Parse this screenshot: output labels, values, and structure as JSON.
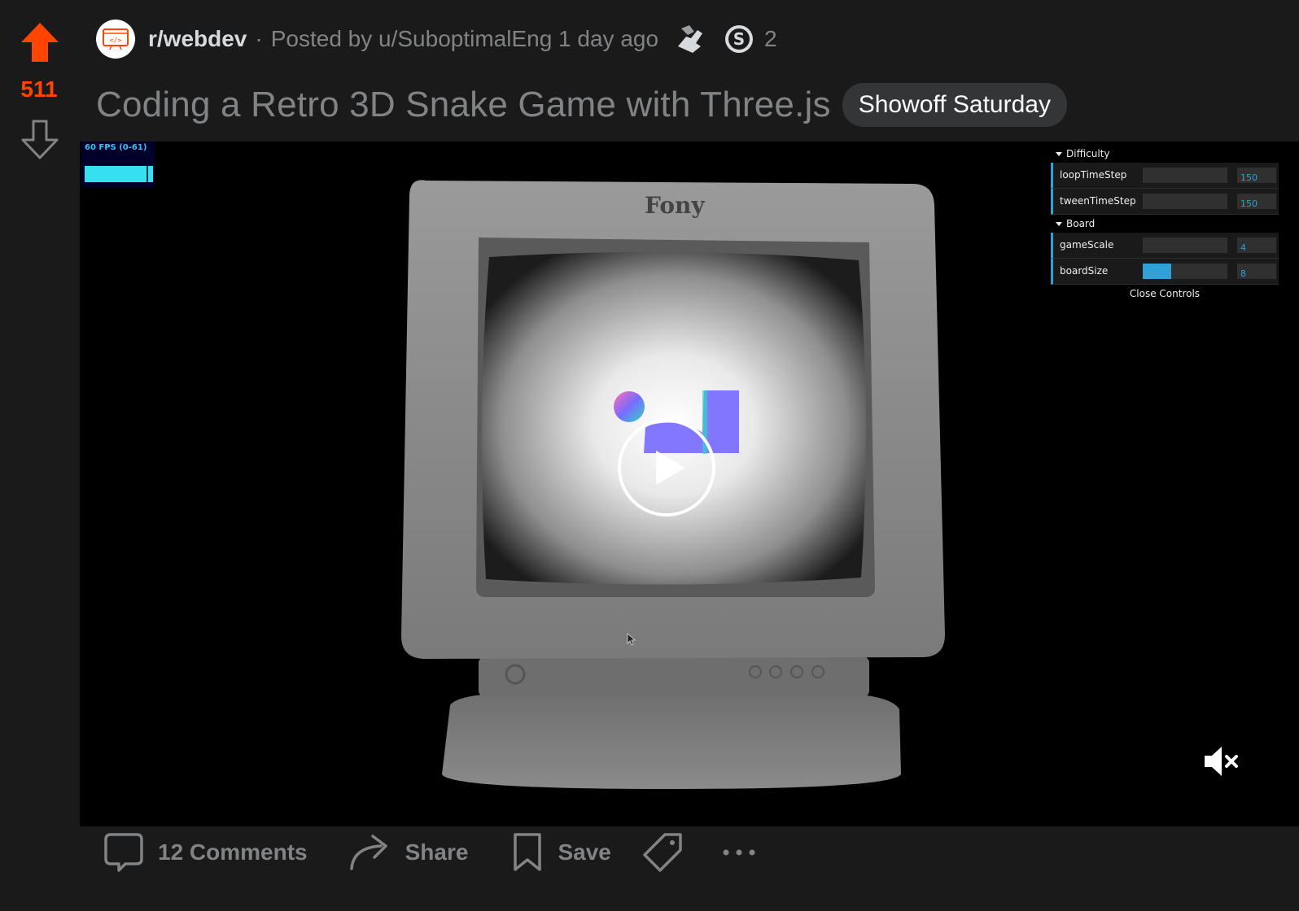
{
  "post": {
    "score": "511",
    "subreddit": "r/webdev",
    "separator": "·",
    "posted_by": "Posted by u/SuboptimalEng 1 day ago",
    "award_count": "2",
    "title": "Coding a Retro 3D Snake Game with Three.js",
    "flair": "Showoff Saturday"
  },
  "video": {
    "fps_label": "60 FPS (0-61)",
    "fps_level": 0.98,
    "monitor_brand": "Fony",
    "gui": {
      "difficulty_folder": "Difficulty",
      "board_folder": "Board",
      "close_label": "Close Controls",
      "controls": [
        {
          "label": "loopTimeStep",
          "value": "150",
          "fill": 0
        },
        {
          "label": "tweenTimeStep",
          "value": "150",
          "fill": 0
        },
        {
          "label": "gameScale",
          "value": "4",
          "fill": 0
        },
        {
          "label": "boardSize",
          "value": "8",
          "fill": 0.34
        }
      ]
    },
    "muted": true
  },
  "actions": {
    "comments": "12 Comments",
    "share": "Share",
    "save": "Save"
  },
  "colors": {
    "upvote": "#ff4500",
    "background": "#1a1a1b",
    "muted_text": "#818384",
    "gui_accent": "#2fa1d6",
    "fps_bar": "#36e0f0"
  },
  "icons": {
    "upvote": "arrow-up-icon",
    "downvote": "arrow-down-icon",
    "subreddit": "code-monitor-icon",
    "awards": [
      "helping-hand-award-icon",
      "silver-award-icon"
    ],
    "play": "play-icon",
    "mute": "mute-icon",
    "comments": "comment-bubble-icon",
    "share": "share-arrow-icon",
    "save": "bookmark-icon",
    "tag": "tag-icon",
    "more": "more-dots-icon"
  }
}
